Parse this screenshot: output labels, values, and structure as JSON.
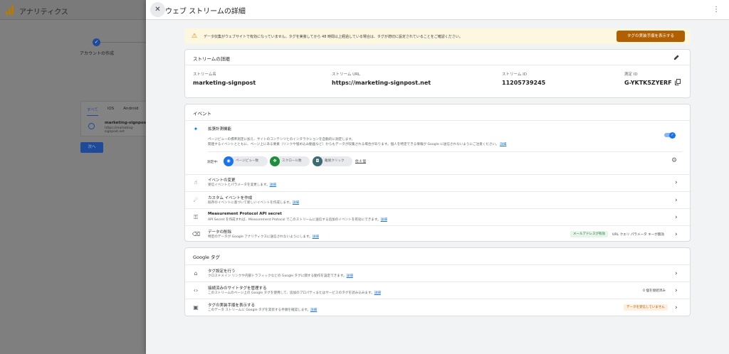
{
  "background": {
    "app_title": "アナリティクス",
    "step_label": "アカウントの作成",
    "tabs": [
      "すべて",
      "iOS",
      "Android"
    ],
    "stream_name": "marketing-signpost",
    "stream_url": "https://marketing-signpost.net",
    "next_button": "次へ"
  },
  "drawer": {
    "title": "ウェブ ストリームの詳細"
  },
  "alert": {
    "text": "データ収集がウェブサイトで有効になっていません。タグを実装してから 48 時間以上経過している場合は、タグが適切に設定されていることをご確認ください。",
    "button": "タグの実装手順を表示する"
  },
  "stream": {
    "section_title": "ストリームの詳細",
    "fields": [
      {
        "label": "ストリーム名",
        "value": "marketing-signpost"
      },
      {
        "label": "ストリーム URL",
        "value": "https://marketing-signpost.net"
      },
      {
        "label": "ストリーム ID",
        "value": "11205739245"
      },
      {
        "label": "測定 ID",
        "value": "G-YKTK5ZYERF"
      }
    ]
  },
  "events": {
    "section_title": "イベント",
    "enhanced": {
      "title": "拡張計測機能",
      "desc1": "ページビューの標準測定に加え、サイトのコンテンツとのインタラクションを自動的に測定します。",
      "desc2": "関連するイベントとともに、ページ上にある要素（リンクや埋め込み動画など）からもデータが収集される場合があります。個人を特定できる情報が Google に送信されないようにご注意ください。",
      "link": "詳細",
      "measuring_label": "測定中:",
      "pills": [
        "ページビュー数",
        "スクロール数",
        "離脱クリック"
      ],
      "more": "他 4 個",
      "enabled": true
    },
    "rows": [
      {
        "title": "イベントの変更",
        "desc": "受信イベントとパラメータを変更します。",
        "link": "詳細"
      },
      {
        "title": "カスタム イベントを作成",
        "desc": "既存のイベントに基づいて新しいイベントを作成します。",
        "link": "詳細"
      },
      {
        "title": "Measurement Protocol API secret",
        "desc": "API Secret を作成すれば、Measurement Protocol でこのストリームに送信する追加のイベントを有効にできます。",
        "link": "詳細"
      },
      {
        "title": "データの削除",
        "desc": "特定のデータが Google アナリティクスに送信されないようにします。",
        "link": "詳細",
        "badge": "メールアドレスが有効",
        "note": "URL クエリ パラメータ キーが無効"
      }
    ]
  },
  "google_tag": {
    "section_title": "Google タグ",
    "rows": [
      {
        "title": "タグ設定を行う",
        "desc": "クロスドメイン リンクや内部トラフィックなどの Google タグに関する動作を設定できます。",
        "link": "詳細"
      },
      {
        "title": "接続済みのサイトタグを管理する",
        "desc": "このストリームのページ上の Google タグを使用して、追加のプロパティまたはサービスのタグを読み込みます。",
        "link": "詳細",
        "note": "0 個を接続済み"
      },
      {
        "title": "タグの実装手順を表示する",
        "desc": "このデータ ストリームに Google タグを実装する手順を確認します。",
        "link": "詳細",
        "badge": "データを受信していません"
      }
    ]
  },
  "colors": {
    "accent": "#1a73e8",
    "warning": "#b06000",
    "pill_blue": "#1a73e8",
    "pill_green": "#1e8e3e",
    "pill_teal": "#3d6b73"
  }
}
